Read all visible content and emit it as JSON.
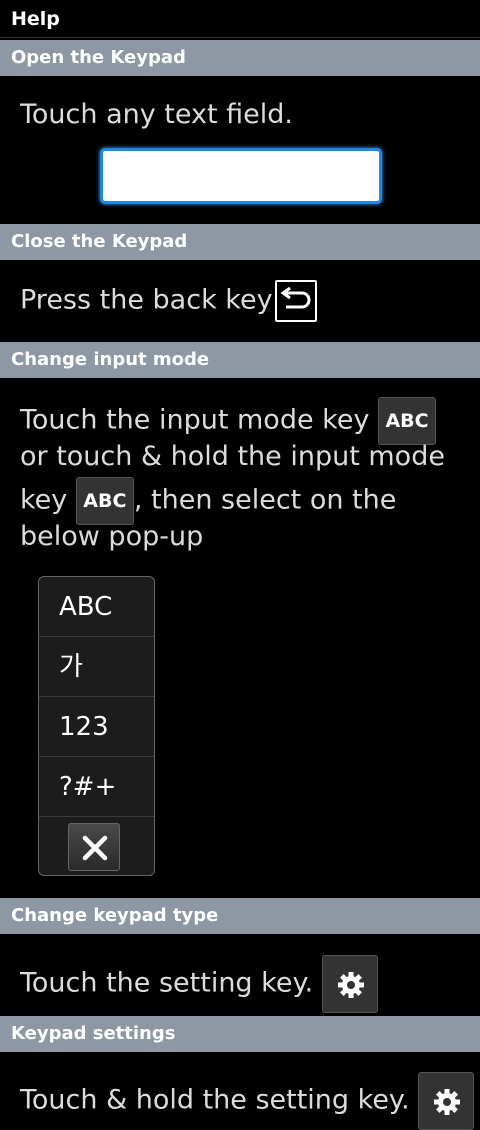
{
  "title": "Help",
  "sections": [
    {
      "header": "Open the Keypad",
      "text": "Touch any text field."
    },
    {
      "header": "Close the Keypad",
      "text": "Press the back key"
    },
    {
      "header": "Change input mode",
      "lines": [
        "Touch the input mode key",
        "or touch & hold the input mode",
        "key",
        ", then select on the",
        "below pop-up"
      ],
      "key_label": "ABC"
    },
    {
      "header": "Change keypad type",
      "text": "Touch the setting key."
    },
    {
      "header": "Keypad settings",
      "text": "Touch & hold the setting key."
    }
  ],
  "popup": {
    "items": [
      "ABC",
      "가",
      "123",
      "?#+"
    ]
  },
  "icons": {
    "back": "back-arrow-icon",
    "settings": "gear-icon",
    "close": "close-icon"
  }
}
